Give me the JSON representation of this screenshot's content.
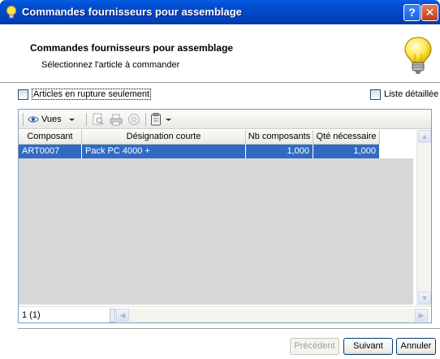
{
  "window": {
    "title": "Commandes fournisseurs pour assemblage",
    "help_label": "?",
    "close_label": "✕"
  },
  "header": {
    "title": "Commandes fournisseurs pour assemblage",
    "subtitle": "Sélectionnez l'article à commander"
  },
  "options": {
    "rupture_label": "Articles en rupture seulement",
    "detail_label": "Liste détaillée",
    "rupture_checked": false,
    "detail_checked": false
  },
  "toolbar": {
    "vues_label": "Vues",
    "icons": [
      "eye-icon",
      "preview-icon",
      "print-icon",
      "email-icon",
      "clipboard-icon"
    ]
  },
  "table": {
    "columns": [
      "Composant",
      "Désignation courte",
      "Nb composants",
      "Qté nécessaire"
    ],
    "rows": [
      [
        "ART0007",
        "Pack PC 4000 +",
        "1,000",
        "1,000"
      ]
    ],
    "selected_row": 0
  },
  "status": {
    "count": "1 (1)"
  },
  "buttons": {
    "previous": "Précédent",
    "next": "Suivant",
    "cancel": "Annuler"
  },
  "colors": {
    "titlebar": "#0048c8",
    "selection": "#316ac5",
    "grid_empty": "#d7d7d7"
  }
}
